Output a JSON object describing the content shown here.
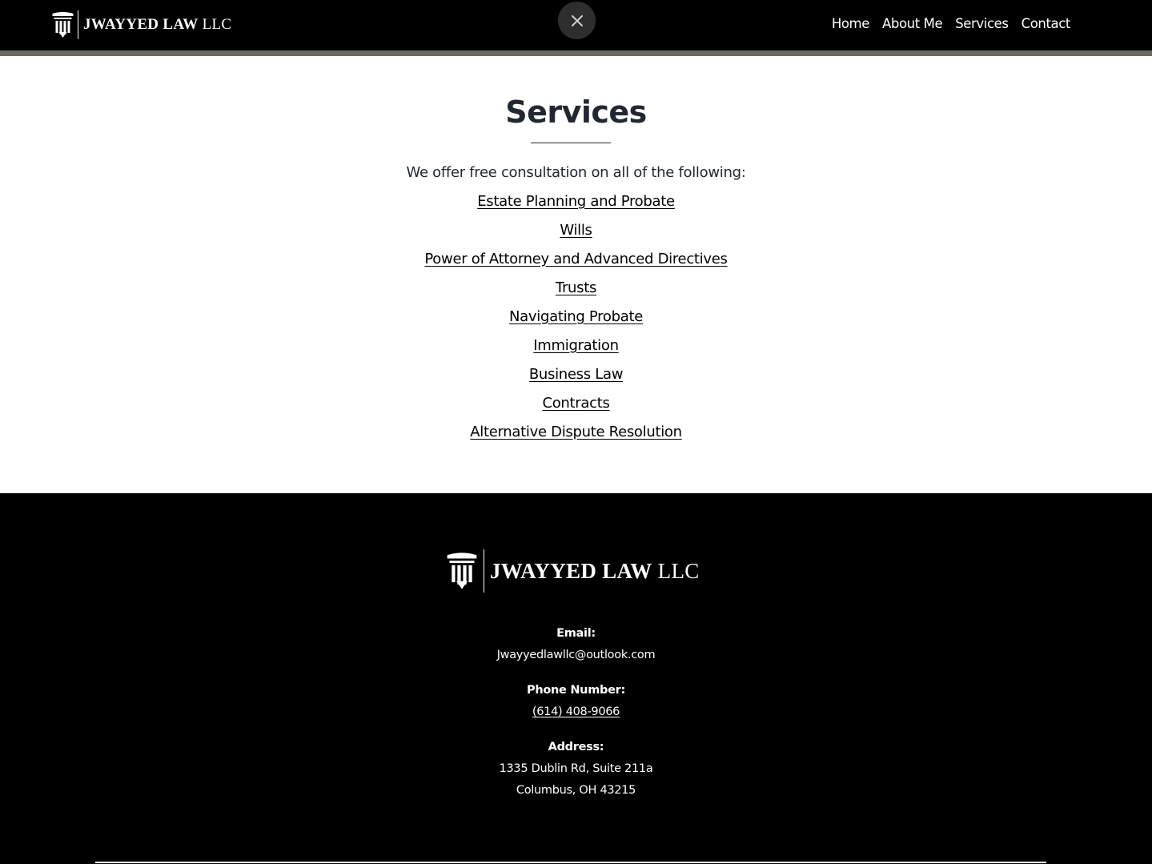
{
  "brand": {
    "name_strong": "JWAYYED LAW",
    "name_light": "LLC"
  },
  "nav": {
    "items": [
      {
        "label": "Home"
      },
      {
        "label": "About Me"
      },
      {
        "label": "Services"
      },
      {
        "label": "Contact"
      }
    ]
  },
  "close_icon": "close-icon",
  "main": {
    "title": "Services",
    "intro": "We offer free consultation on all of the following:",
    "services": [
      {
        "label": "Estate Planning and Probate"
      },
      {
        "label": "Wills"
      },
      {
        "label": "Power of Attorney and Advanced Directives"
      },
      {
        "label": "Trusts"
      },
      {
        "label": "Navigating Probate"
      },
      {
        "label": "Immigration"
      },
      {
        "label": "Business Law"
      },
      {
        "label": "Contracts"
      },
      {
        "label": "Alternative Dispute Resolution"
      }
    ]
  },
  "footer": {
    "email_label": "Email:",
    "email": "Jwayyedlawllc@outlook.com",
    "phone_label": "Phone Number:",
    "phone": "(614) 408-9066",
    "address_label": "Address:",
    "address_line1": "1335 Dublin Rd, Suite 211a",
    "address_line2": "Columbus, OH 43215"
  },
  "colors": {
    "header_bg": "#000000",
    "header_strip": "#6f6a64",
    "heading_text": "#222831",
    "footer_bg": "#000000"
  }
}
